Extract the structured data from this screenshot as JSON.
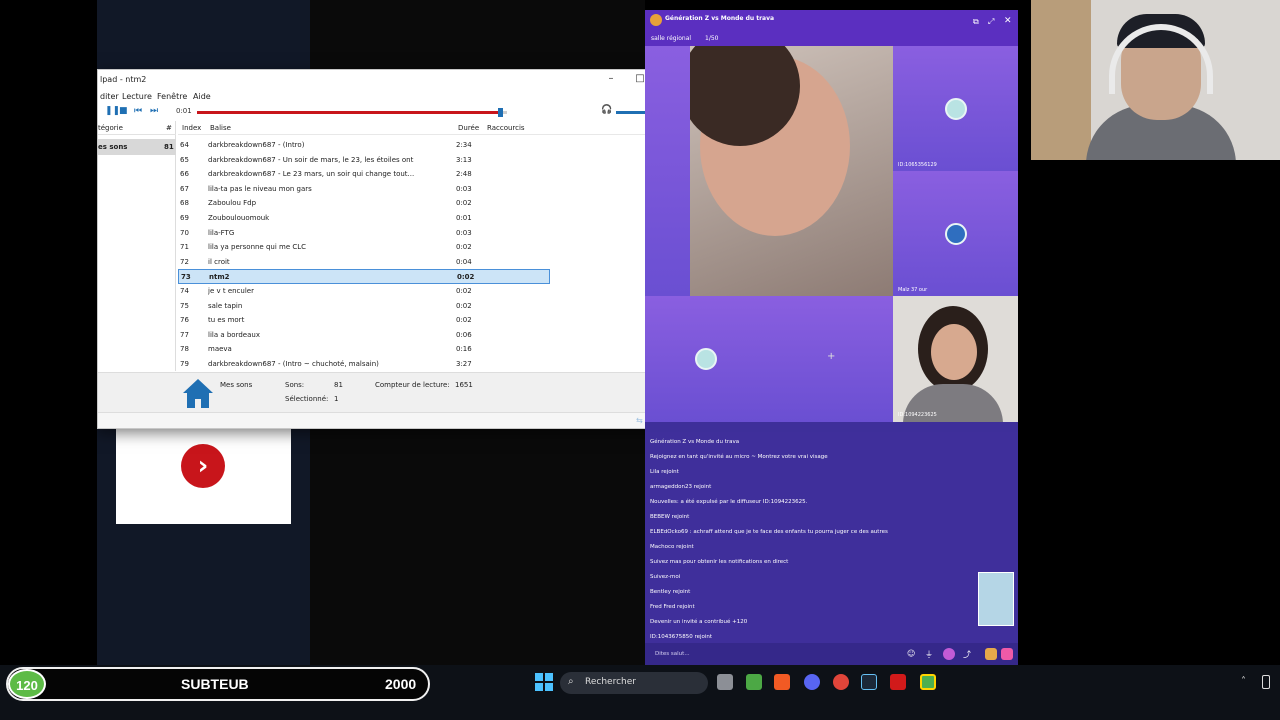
{
  "soundpad": {
    "title": "lpad - ntm2",
    "menu": [
      "diter",
      "Lecture",
      "Fenêtre",
      "Aide"
    ],
    "time": "0:01",
    "seek_progress": 0.99,
    "columns": {
      "index": "Index",
      "tag": "Balise",
      "duration": "Durée",
      "shortcuts": "Raccourcis"
    },
    "category_header": {
      "label": "tégorie",
      "count": "#"
    },
    "category": {
      "label": "es sons",
      "count": "81"
    },
    "rows": [
      {
        "i": "64",
        "tag": "darkbreakdown687 - (Intro)",
        "dur": "2:34"
      },
      {
        "i": "65",
        "tag": "darkbreakdown687 - Un soir de mars, le 23, les étoiles ont",
        "dur": "3:13"
      },
      {
        "i": "66",
        "tag": "darkbreakdown687 - Le 23 mars, un soir qui change tout...",
        "dur": "2:48"
      },
      {
        "i": "67",
        "tag": "lila-ta pas le niveau mon gars",
        "dur": "0:03"
      },
      {
        "i": "68",
        "tag": "Zaboulou Fdp",
        "dur": "0:02"
      },
      {
        "i": "69",
        "tag": "Zouboulouomouk",
        "dur": "0:01"
      },
      {
        "i": "70",
        "tag": "lila-FTG",
        "dur": "0:03"
      },
      {
        "i": "71",
        "tag": "lila ya personne qui me CLC",
        "dur": "0:02"
      },
      {
        "i": "72",
        "tag": "il croit",
        "dur": "0:04"
      },
      {
        "i": "73",
        "tag": "ntm2",
        "dur": "0:02"
      },
      {
        "i": "74",
        "tag": "je v t enculer",
        "dur": "0:02"
      },
      {
        "i": "75",
        "tag": "sale tapin",
        "dur": "0:02"
      },
      {
        "i": "76",
        "tag": "tu es mort",
        "dur": "0:02"
      },
      {
        "i": "77",
        "tag": "lila a bordeaux",
        "dur": "0:06"
      },
      {
        "i": "78",
        "tag": "maeva",
        "dur": "0:16"
      },
      {
        "i": "79",
        "tag": "darkbreakdown687 - (Intro ~ chuchoté, malsain)",
        "dur": "3:27"
      }
    ],
    "footer": {
      "folder": "Mes sons",
      "sounds_label": "Sons:",
      "sounds_value": "81",
      "selected_label": "Sélectionné:",
      "selected_value": "1",
      "play_counter_label": "Compteur de lecture:",
      "play_counter_value": "1651"
    }
  },
  "live": {
    "room_title": "Génération Z vs Monde du trava",
    "room_tag": "salle régional",
    "room_count": "1/50",
    "tile_ids": [
      "ID:1065356129",
      "Maïz 37 our"
    ],
    "tile_id_bottom": "ID:1094223625",
    "chat": [
      "Génération Z vs Monde du trava",
      "Rejoignez en tant qu'invité au micro ~ Montrez votre vrai visage",
      "Lila rejoint",
      "armageddon23 rejoint",
      "Nouvelles: a été expulsé par le diffuseur ID:1094223625.",
      "BEBEW rejoint",
      "ELBEdOcko69 : achraff attend que je te face des enfants tu pourra juger ce des autres",
      "Machoco rejoint",
      "Suivez mas pour obtenir les notifications en direct",
      "Suivez-moi",
      "Bentley rejoint",
      "Fred Fred rejoint",
      "Devenir un invité a contribué +120",
      "ID:1043675850 rejoint"
    ],
    "chat_input_placeholder": "Dites salut..."
  },
  "stream_bar": {
    "badge": "120",
    "label": "SUBTEUB",
    "goal": "2000"
  },
  "taskbar": {
    "search_label": "Rechercher"
  },
  "colors": {
    "accent": "#1f6fb3",
    "seek": "#c8151b",
    "selected_row": "#cce4f7",
    "live_purple": "#5b2fc0"
  }
}
